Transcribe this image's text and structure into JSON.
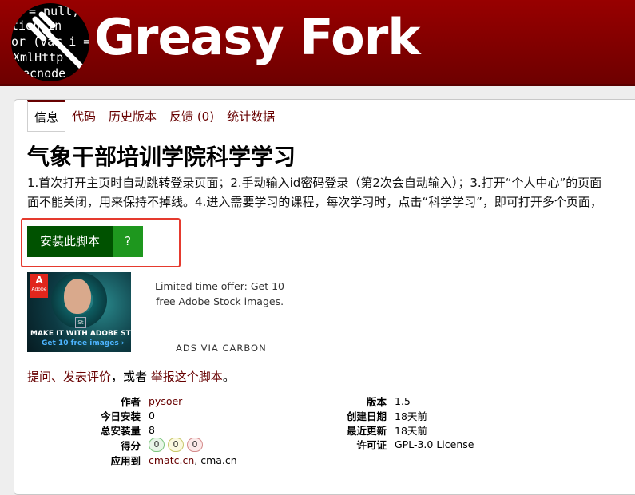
{
  "site": {
    "name": "Greasy Fork",
    "logo_code_lines": [
      "= null,",
      "tion in",
      "or (var i = 0",
      "XmlHttp",
      "ecnode"
    ]
  },
  "tabs": [
    {
      "label": "信息",
      "active": true
    },
    {
      "label": "代码",
      "active": false
    },
    {
      "label": "历史版本",
      "active": false
    },
    {
      "label": "反馈 (0)",
      "active": false
    },
    {
      "label": "统计数据",
      "active": false
    }
  ],
  "script": {
    "title": "气象干部培训学院科学学习",
    "description_line1": "1.首次打开主页时自动跳转登录页面；2.手动输入id密码登录（第2次会自动输入）；3.打开“个人中心”的页面",
    "description_line2": "面不能关闭，用来保持不掉线。4.进入需要学习的课程，每次学习时，点击“科学学习”，即可打开多个页面，",
    "install_label": "安装此脚本",
    "install_help_label": "?"
  },
  "ad": {
    "brand_text": "Adobe",
    "badge_text": "St",
    "image_line1": "MAKE IT WITH ADOBE STOCK.",
    "image_line2": "Get 10 free images ›",
    "text": "Limited time offer: Get 10 free Adobe Stock images.",
    "via": "ADS VIA CARBON"
  },
  "feedback": {
    "link1": "提问、发表评价",
    "middle": "，或者 ",
    "link2": "举报这个脚本",
    "end": "。"
  },
  "info_left": {
    "author_label": "作者",
    "author_value": "pysoer",
    "daily_label": "今日安装",
    "daily_value": "0",
    "total_label": "总安装量",
    "total_value": "8",
    "rating_label": "得分",
    "ratings": {
      "good": "0",
      "ok": "0",
      "bad": "0"
    },
    "applies_label": "应用到",
    "applies_link": "cmatc.cn",
    "applies_rest": ", cma.cn"
  },
  "info_right": {
    "version_label": "版本",
    "version_value": "1.5",
    "created_label": "创建日期",
    "created_value": "18天前",
    "updated_label": "最近更新",
    "updated_value": "18天前",
    "license_label": "许可证",
    "license_value": "GPL-3.0 License"
  },
  "colors": {
    "header": "#8b0000",
    "link": "#670000",
    "install": "#005200",
    "install_help": "#1e971e",
    "highlight": "#e53a2e"
  }
}
